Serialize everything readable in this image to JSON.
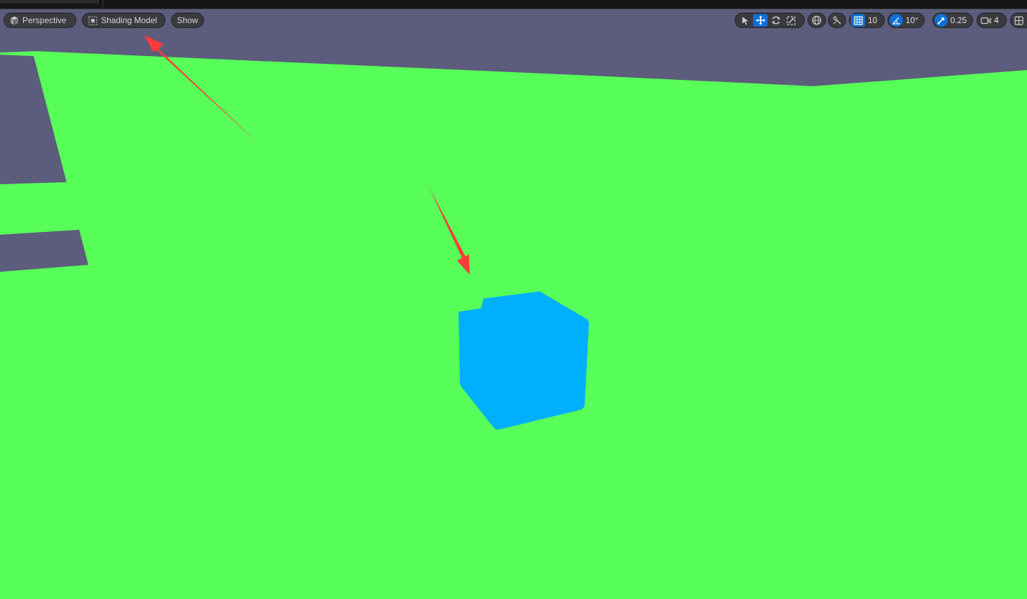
{
  "toolbar": {
    "left": {
      "perspective_label": "Perspective",
      "shading_label": "Shading Model",
      "show_label": "Show"
    },
    "right": {
      "grid_snap_value": "10",
      "rotation_snap_value": "10°",
      "scale_snap_value": "0.25",
      "camera_speed_value": "4"
    }
  },
  "icons": {
    "perspective": "cube-icon",
    "shading": "shading-model-icon",
    "select": "select-arrow-icon",
    "translate": "move-icon",
    "rotate": "rotate-icon",
    "scale": "scale-icon",
    "world": "globe-icon",
    "surface_snap": "surface-snap-icon",
    "grid": "grid-icon",
    "angle": "angle-icon",
    "scale_snap": "scale-snap-icon",
    "camera": "camera-icon",
    "layout": "layout-icon"
  },
  "colors": {
    "sky": "#5c5c7c",
    "ground": "#58ff58",
    "cube": "#00b0ff",
    "accent": "#0f6fd6",
    "annotation": "#ff3333"
  }
}
